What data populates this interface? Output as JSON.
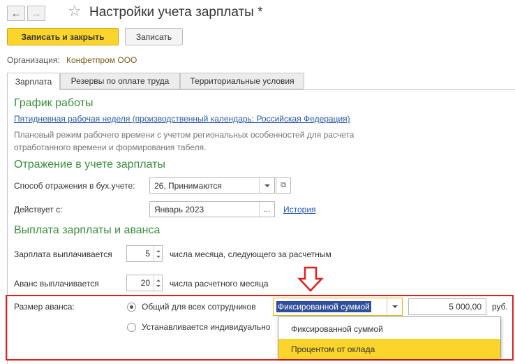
{
  "titlebar": {
    "title": "Настройки учета зарплаты *",
    "back_icon": "arrow-left",
    "forward_icon": "arrow-right"
  },
  "toolbar": {
    "save_close_label": "Записать и закрыть",
    "save_label": "Записать"
  },
  "organization": {
    "label": "Организация:",
    "value": "Конфетпром ООО"
  },
  "tabs": [
    {
      "label": "Зарплата",
      "active": true
    },
    {
      "label": "Резервы по оплате труда",
      "active": false
    },
    {
      "label": "Территориальные условия",
      "active": false
    }
  ],
  "schedule": {
    "heading": "График работы",
    "link": "Пятидневная рабочая неделя (производственный календарь: Российская Федерация)",
    "note_line1": "Плановый режим рабочего времени с учетом региональных особенностей для расчета",
    "note_line2": "отработанного времени и формирования табеля."
  },
  "accounting": {
    "heading": "Отражение в учете зарплаты",
    "method_label": "Способ отражения в бух.учете:",
    "method_value": "26, Принимаются",
    "effective_label": "Действует с:",
    "effective_value": "Январь 2023",
    "ellipsis": "...",
    "history_link": "История"
  },
  "payment": {
    "heading": "Выплата зарплаты и аванса",
    "salary_label": "Зарплата выплачивается",
    "salary_day": "5",
    "salary_suffix": "числа месяца, следующего за расчетным",
    "advance_label": "Аванс выплачивается",
    "advance_day": "20",
    "advance_suffix": "числа расчетного месяца",
    "advance_size_label": "Размер аванса:",
    "option_common": "Общий для всех сотрудников",
    "option_individual": "Устанавливается индивидуально",
    "mode_value": "Фиксированной суммой",
    "amount": "5 000,00",
    "currency": "руб."
  },
  "dropdown": {
    "items": [
      "Фиксированной суммой",
      "Процентом от оклада"
    ],
    "highlighted_index": 1
  },
  "colors": {
    "accent_yellow": "#fbd52c",
    "heading_green": "#3c8f3c",
    "link_blue": "#2a58a7",
    "highlight_red": "#e02020"
  }
}
